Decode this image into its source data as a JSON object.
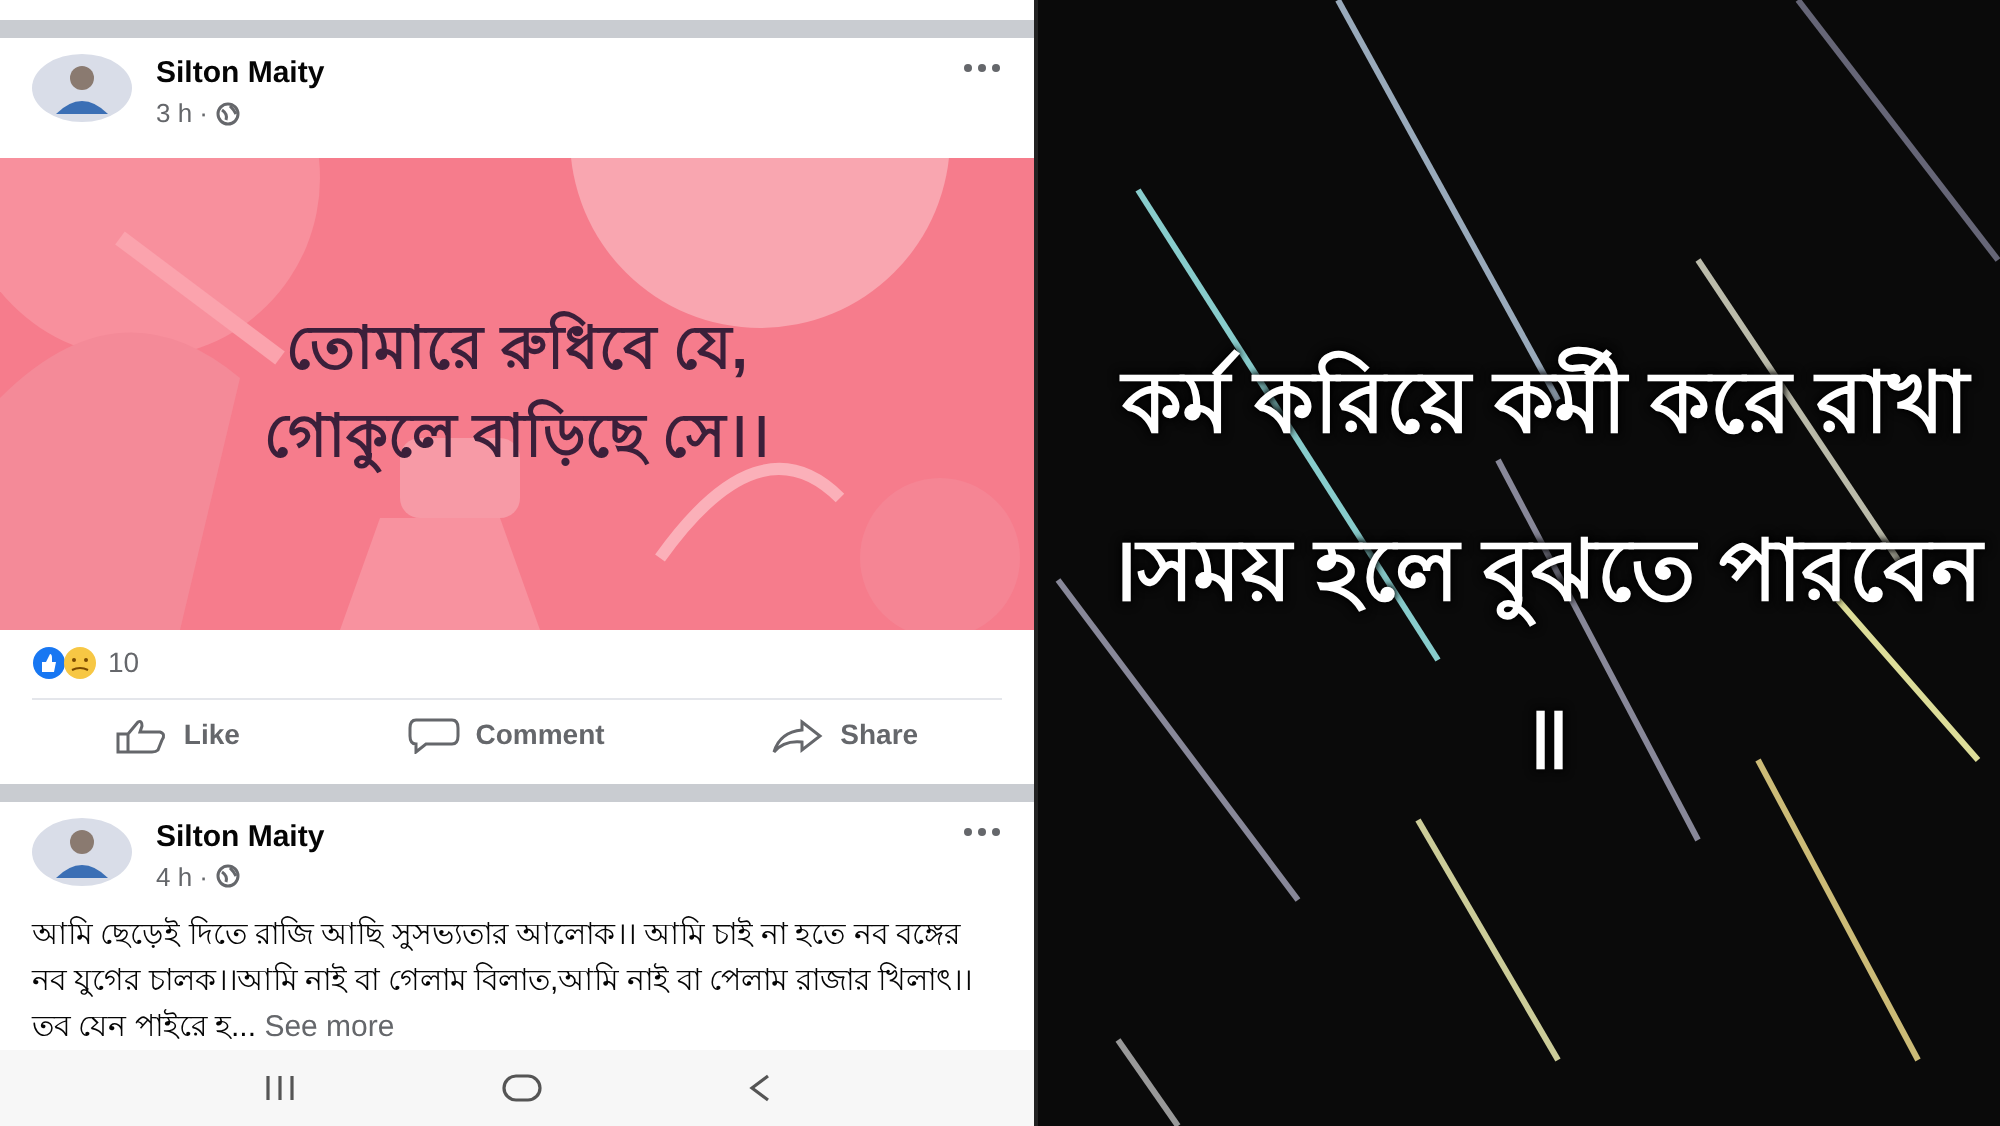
{
  "feed": {
    "posts": [
      {
        "kind": "background_text",
        "author": "Silton Maity",
        "time": "3 h ·",
        "lines": [
          "তোমারে রুধিবে যে,",
          "গোকুলে বাড়িছে সে।।"
        ],
        "reaction_count": "10",
        "actions": [
          "Like",
          "Comment",
          "Share"
        ]
      },
      {
        "kind": "text",
        "author": "Silton Maity",
        "time": "4 h ·",
        "body": "আমি ছেড়েই দিতে রাজি আছি সুসভ্যতার আলোক।। আমি চাই না হতে নব বঙ্গের নব যুগের চালক।।আমি নাই বা গেলাম বিলাত,আমি নাই বা পেলাম রাজার খিলাৎ।। তব যেন পাইরে হ...",
        "see_more": "See more"
      }
    ]
  },
  "quote_image": {
    "text": "কর্ম করিয়ে কর্মী করে রাখা ।সময় হলে বুঝতে পারবেন ॥"
  }
}
